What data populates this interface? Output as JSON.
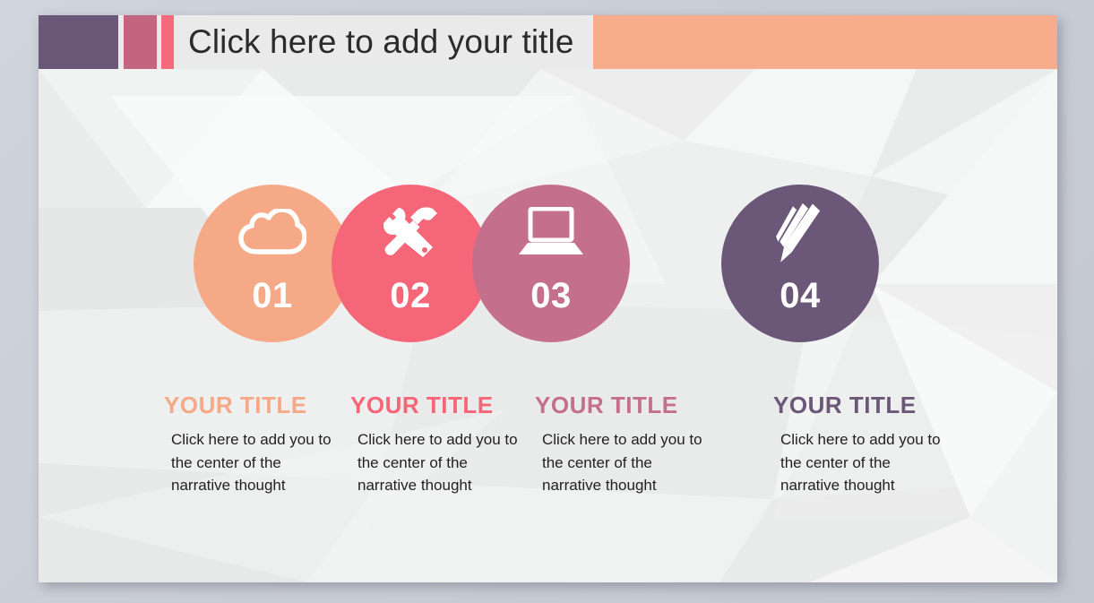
{
  "slide": {
    "header": {
      "title": "Click here to add your title",
      "accent_blocks": [
        {
          "name": "purple-block",
          "color": "#6b5878"
        },
        {
          "name": "rose-block",
          "color": "#c4657f"
        },
        {
          "name": "coral-strip",
          "color": "#f5697c"
        }
      ],
      "peach_bar_color": "#f7ac8b"
    },
    "steps": [
      {
        "number": "01",
        "icon": "cloud-icon",
        "color": "#f5a986",
        "title": "YOUR  TITLE",
        "body": "Click here to add you to the center of the narrative thought"
      },
      {
        "number": "02",
        "icon": "tools-icon",
        "color": "#f56679",
        "title": "YOUR  TITLE",
        "body": "Click here to add you to the center of the narrative thought"
      },
      {
        "number": "03",
        "icon": "laptop-icon",
        "color": "#c4708d",
        "title": "YOUR  TITLE",
        "body": "Click here to add you to the center of the narrative thought"
      },
      {
        "number": "04",
        "icon": "pencil-icon",
        "color": "#6b5878",
        "title": "YOUR  TITLE",
        "body": "Click here to add you to the center of the narrative thought"
      }
    ],
    "colors": {
      "canvas_background": "#ccd0d8",
      "slide_background": "#eceded",
      "header_background": "#eaeaea",
      "title_text": "#2b2b2b",
      "body_text": "#231f20"
    }
  }
}
